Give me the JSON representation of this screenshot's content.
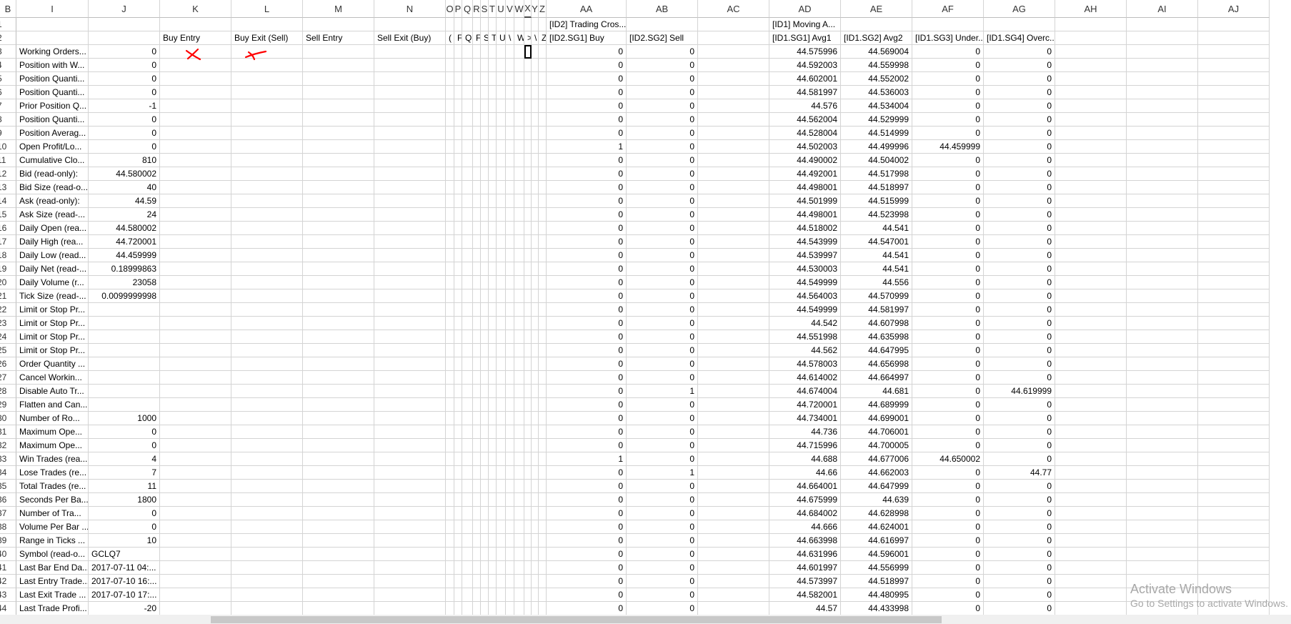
{
  "columns": [
    {
      "label": "B"
    },
    {
      "label": "I"
    },
    {
      "label": "J"
    },
    {
      "label": "K"
    },
    {
      "label": "L"
    },
    {
      "label": "M"
    },
    {
      "label": "N"
    },
    {
      "label": "O"
    },
    {
      "label": "P"
    },
    {
      "label": "Q"
    },
    {
      "label": "R"
    },
    {
      "label": "S"
    },
    {
      "label": "T"
    },
    {
      "label": "U"
    },
    {
      "label": "V"
    },
    {
      "label": "W"
    },
    {
      "label": "X"
    },
    {
      "label": "Y"
    },
    {
      "label": "Z"
    },
    {
      "label": "AA"
    },
    {
      "label": "AB"
    },
    {
      "label": "AC"
    },
    {
      "label": "AD"
    },
    {
      "label": "AE"
    },
    {
      "label": "AF"
    },
    {
      "label": "AG"
    },
    {
      "label": "AH"
    },
    {
      "label": "AI"
    },
    {
      "label": "AJ"
    }
  ],
  "selected_cell": "X3",
  "header_rows": {
    "row1": {
      "AA": "[ID2] Trading Cros...",
      "AD": "[ID1] Moving A..."
    },
    "row2": {
      "K": "Buy Entry",
      "L": "Buy Exit (Sell)",
      "M": "Sell Entry",
      "N": "Sell Exit (Buy)",
      "O": "(",
      "P": "F",
      "Q": "Q",
      "R": "F",
      "S": "S",
      "T": "T",
      "U": "U",
      "V": "\\",
      "W": "W",
      "X": ">",
      "Y": "\\",
      "Z": "Z",
      "AA": "[ID2.SG1] Buy",
      "AB": "[ID2.SG2] Sell",
      "AD": "[ID1.SG1] Avg1",
      "AE": "[ID1.SG2] Avg2",
      "AF": "[ID1.SG3] Under...",
      "AG": "[ID1.SG4] Overc..."
    }
  },
  "rows": [
    {
      "n": "3",
      "label": "Working Orders...",
      "value": "0",
      "aa": "0",
      "ab": "0",
      "ad": "44.575996",
      "ae": "44.569004",
      "af": "0",
      "ag": "0"
    },
    {
      "n": "4",
      "label": "Position with W...",
      "value": "0",
      "aa": "0",
      "ab": "0",
      "ad": "44.592003",
      "ae": "44.559998",
      "af": "0",
      "ag": "0"
    },
    {
      "n": "5",
      "label": "Position Quanti...",
      "value": "0",
      "aa": "0",
      "ab": "0",
      "ad": "44.602001",
      "ae": "44.552002",
      "af": "0",
      "ag": "0"
    },
    {
      "n": "6",
      "label": "Position Quanti...",
      "value": "0",
      "aa": "0",
      "ab": "0",
      "ad": "44.581997",
      "ae": "44.536003",
      "af": "0",
      "ag": "0"
    },
    {
      "n": "7",
      "label": "Prior Position Q...",
      "value": "-1",
      "aa": "0",
      "ab": "0",
      "ad": "44.576",
      "ae": "44.534004",
      "af": "0",
      "ag": "0"
    },
    {
      "n": "8",
      "label": "Position Quanti...",
      "value": "0",
      "aa": "0",
      "ab": "0",
      "ad": "44.562004",
      "ae": "44.529999",
      "af": "0",
      "ag": "0"
    },
    {
      "n": "9",
      "label": "Position Averag...",
      "value": "0",
      "aa": "0",
      "ab": "0",
      "ad": "44.528004",
      "ae": "44.514999",
      "af": "0",
      "ag": "0"
    },
    {
      "n": "10",
      "label": "Open Profit/Lo...",
      "value": "0",
      "aa": "1",
      "ab": "0",
      "ad": "44.502003",
      "ae": "44.499996",
      "af": "44.459999",
      "ag": "0"
    },
    {
      "n": "11",
      "label": "Cumulative Clo...",
      "value": "810",
      "aa": "0",
      "ab": "0",
      "ad": "44.490002",
      "ae": "44.504002",
      "af": "0",
      "ag": "0"
    },
    {
      "n": "12",
      "label": "Bid (read-only):",
      "value": "44.580002",
      "aa": "0",
      "ab": "0",
      "ad": "44.492001",
      "ae": "44.517998",
      "af": "0",
      "ag": "0"
    },
    {
      "n": "13",
      "label": "Bid Size (read-o...",
      "value": "40",
      "aa": "0",
      "ab": "0",
      "ad": "44.498001",
      "ae": "44.518997",
      "af": "0",
      "ag": "0"
    },
    {
      "n": "14",
      "label": "Ask (read-only):",
      "value": "44.59",
      "aa": "0",
      "ab": "0",
      "ad": "44.501999",
      "ae": "44.515999",
      "af": "0",
      "ag": "0"
    },
    {
      "n": "15",
      "label": "Ask Size (read-...",
      "value": "24",
      "aa": "0",
      "ab": "0",
      "ad": "44.498001",
      "ae": "44.523998",
      "af": "0",
      "ag": "0"
    },
    {
      "n": "16",
      "label": "Daily Open (rea...",
      "value": "44.580002",
      "aa": "0",
      "ab": "0",
      "ad": "44.518002",
      "ae": "44.541",
      "af": "0",
      "ag": "0"
    },
    {
      "n": "17",
      "label": "Daily High (rea...",
      "value": "44.720001",
      "aa": "0",
      "ab": "0",
      "ad": "44.543999",
      "ae": "44.547001",
      "af": "0",
      "ag": "0"
    },
    {
      "n": "18",
      "label": "Daily Low (read...",
      "value": "44.459999",
      "aa": "0",
      "ab": "0",
      "ad": "44.539997",
      "ae": "44.541",
      "af": "0",
      "ag": "0"
    },
    {
      "n": "19",
      "label": "Daily Net (read-...",
      "value": "0.18999863",
      "aa": "0",
      "ab": "0",
      "ad": "44.530003",
      "ae": "44.541",
      "af": "0",
      "ag": "0"
    },
    {
      "n": "20",
      "label": "Daily Volume (r...",
      "value": "23058",
      "aa": "0",
      "ab": "0",
      "ad": "44.549999",
      "ae": "44.556",
      "af": "0",
      "ag": "0"
    },
    {
      "n": "21",
      "label": "Tick Size (read-...",
      "value": "0.0099999998",
      "aa": "0",
      "ab": "0",
      "ad": "44.564003",
      "ae": "44.570999",
      "af": "0",
      "ag": "0"
    },
    {
      "n": "22",
      "label": "Limit or Stop Pr...",
      "value": "",
      "aa": "0",
      "ab": "0",
      "ad": "44.549999",
      "ae": "44.581997",
      "af": "0",
      "ag": "0"
    },
    {
      "n": "23",
      "label": "Limit or Stop Pr...",
      "value": "",
      "aa": "0",
      "ab": "0",
      "ad": "44.542",
      "ae": "44.607998",
      "af": "0",
      "ag": "0"
    },
    {
      "n": "24",
      "label": "Limit or Stop Pr...",
      "value": "",
      "aa": "0",
      "ab": "0",
      "ad": "44.551998",
      "ae": "44.635998",
      "af": "0",
      "ag": "0"
    },
    {
      "n": "25",
      "label": "Limit or Stop Pr...",
      "value": "",
      "aa": "0",
      "ab": "0",
      "ad": "44.562",
      "ae": "44.647995",
      "af": "0",
      "ag": "0"
    },
    {
      "n": "26",
      "label": "Order Quantity ...",
      "value": "",
      "aa": "0",
      "ab": "0",
      "ad": "44.578003",
      "ae": "44.656998",
      "af": "0",
      "ag": "0"
    },
    {
      "n": "27",
      "label": "Cancel Workin...",
      "value": "",
      "aa": "0",
      "ab": "0",
      "ad": "44.614002",
      "ae": "44.664997",
      "af": "0",
      "ag": "0"
    },
    {
      "n": "28",
      "label": "Disable Auto Tr...",
      "value": "",
      "aa": "0",
      "ab": "1",
      "ad": "44.674004",
      "ae": "44.681",
      "af": "0",
      "ag": "44.619999"
    },
    {
      "n": "29",
      "label": "Flatten and Can...",
      "value": "",
      "aa": "0",
      "ab": "0",
      "ad": "44.720001",
      "ae": "44.689999",
      "af": "0",
      "ag": "0"
    },
    {
      "n": "30",
      "label": "Number of Ro...",
      "value": "1000",
      "aa": "0",
      "ab": "0",
      "ad": "44.734001",
      "ae": "44.699001",
      "af": "0",
      "ag": "0"
    },
    {
      "n": "31",
      "label": "Maximum Ope...",
      "value": "0",
      "aa": "0",
      "ab": "0",
      "ad": "44.736",
      "ae": "44.706001",
      "af": "0",
      "ag": "0"
    },
    {
      "n": "32",
      "label": "Maximum Ope...",
      "value": "0",
      "aa": "0",
      "ab": "0",
      "ad": "44.715996",
      "ae": "44.700005",
      "af": "0",
      "ag": "0"
    },
    {
      "n": "33",
      "label": "Win Trades (rea...",
      "value": "4",
      "aa": "1",
      "ab": "0",
      "ad": "44.688",
      "ae": "44.677006",
      "af": "44.650002",
      "ag": "0"
    },
    {
      "n": "34",
      "label": "Lose Trades (re...",
      "value": "7",
      "aa": "0",
      "ab": "1",
      "ad": "44.66",
      "ae": "44.662003",
      "af": "0",
      "ag": "44.77"
    },
    {
      "n": "35",
      "label": "Total Trades (re...",
      "value": "11",
      "aa": "0",
      "ab": "0",
      "ad": "44.664001",
      "ae": "44.647999",
      "af": "0",
      "ag": "0"
    },
    {
      "n": "36",
      "label": "Seconds Per Ba...",
      "value": "1800",
      "aa": "0",
      "ab": "0",
      "ad": "44.675999",
      "ae": "44.639",
      "af": "0",
      "ag": "0"
    },
    {
      "n": "37",
      "label": "Number of Tra...",
      "value": "0",
      "aa": "0",
      "ab": "0",
      "ad": "44.684002",
      "ae": "44.628998",
      "af": "0",
      "ag": "0"
    },
    {
      "n": "38",
      "label": "Volume Per Bar ...",
      "value": "0",
      "aa": "0",
      "ab": "0",
      "ad": "44.666",
      "ae": "44.624001",
      "af": "0",
      "ag": "0"
    },
    {
      "n": "39",
      "label": "Range in Ticks ...",
      "value": "10",
      "aa": "0",
      "ab": "0",
      "ad": "44.663998",
      "ae": "44.616997",
      "af": "0",
      "ag": "0"
    },
    {
      "n": "40",
      "label": "Symbol (read-o...",
      "value": "GCLQ7",
      "value_align": "left",
      "aa": "0",
      "ab": "0",
      "ad": "44.631996",
      "ae": "44.596001",
      "af": "0",
      "ag": "0"
    },
    {
      "n": "41",
      "label": "Last Bar End Da...",
      "value": "2017-07-11  04:...",
      "value_align": "left",
      "aa": "0",
      "ab": "0",
      "ad": "44.601997",
      "ae": "44.556999",
      "af": "0",
      "ag": "0"
    },
    {
      "n": "42",
      "label": "Last Entry Trade...",
      "value": "2017-07-10  16:...",
      "value_align": "left",
      "aa": "0",
      "ab": "0",
      "ad": "44.573997",
      "ae": "44.518997",
      "af": "0",
      "ag": "0"
    },
    {
      "n": "43",
      "label": "Last Exit Trade ...",
      "value": "2017-07-10  17:...",
      "value_align": "left",
      "aa": "0",
      "ab": "0",
      "ad": "44.582001",
      "ae": "44.480995",
      "af": "0",
      "ag": "0"
    },
    {
      "n": "44",
      "label": "Last Trade Profi...",
      "value": "-20",
      "aa": "0",
      "ab": "0",
      "ad": "44.57",
      "ae": "44.433998",
      "af": "0",
      "ag": "0"
    }
  ],
  "annotations": [
    {
      "name": "red-x-mark-buy-entry",
      "color": "#ff0000"
    },
    {
      "name": "red-x-mark-buy-exit",
      "color": "#ff0000"
    }
  ],
  "watermark": {
    "title": "Activate Windows",
    "subtitle": "Go to Settings to activate Windows."
  },
  "colors": {
    "grid": "#d4d4d4",
    "header_border": "#bdbdbd",
    "watermark": "#a8a8a8",
    "annotation": "#ff0000"
  }
}
